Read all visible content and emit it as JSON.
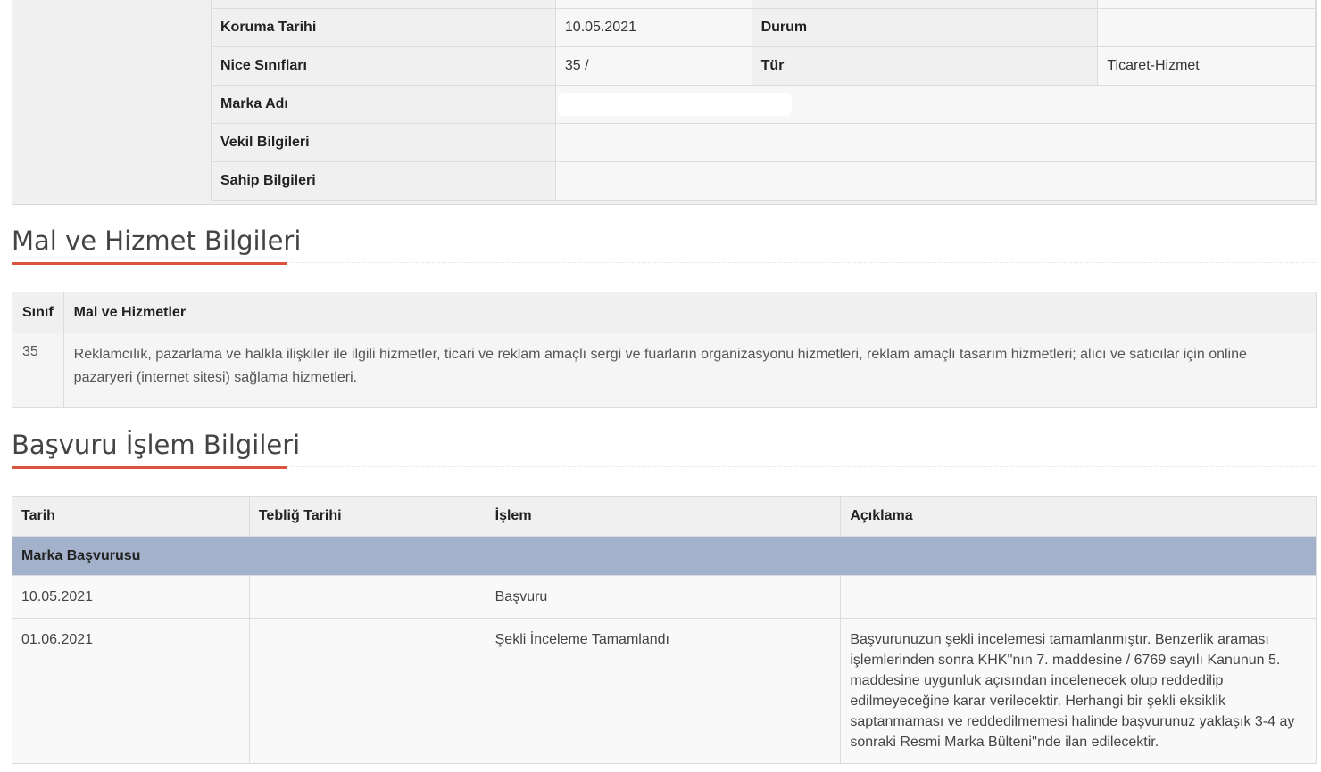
{
  "trademark_info": {
    "rows": [
      {
        "label": "Koruma Tarihi",
        "value": "10.05.2021",
        "label2": "Durum",
        "value2": ""
      },
      {
        "label": "Nice Sınıfları",
        "value": "35 /",
        "label2": "Tür",
        "value2": "Ticaret-Hizmet"
      },
      {
        "label": "Marka Adı",
        "value": ""
      },
      {
        "label": "Vekil Bilgileri",
        "value": ""
      },
      {
        "label": "Sahip Bilgileri",
        "value": ""
      }
    ]
  },
  "goods_section": {
    "title": "Mal ve Hizmet Bilgileri",
    "headers": {
      "class": "Sınıf",
      "goods": "Mal ve Hizmetler"
    },
    "rows": [
      {
        "class": "35",
        "goods": "Reklamcılık, pazarlama ve halkla ilişkiler ile ilgili hizmetler, ticari ve reklam amaçlı sergi ve fuarların organizasyonu hizmetleri, reklam amaçlı tasarım hizmetleri; alıcı ve satıcılar için online pazaryeri (internet sitesi) sağlama hizmetleri."
      }
    ]
  },
  "transactions_section": {
    "title": "Başvuru İşlem Bilgileri",
    "headers": {
      "date": "Tarih",
      "notify_date": "Tebliğ Tarihi",
      "action": "İşlem",
      "description": "Açıklama"
    },
    "group_label": "Marka Başvurusu",
    "rows": [
      {
        "date": "10.05.2021",
        "notify_date": "",
        "action": "Başvuru",
        "description": ""
      },
      {
        "date": "01.06.2021",
        "notify_date": "",
        "action": "Şekli İnceleme Tamamlandı",
        "description": "Başvurunuzun şekli incelemesi tamamlanmıştır. Benzerlik araması işlemlerinden sonra KHK''nın 7. maddesine / 6769 sayılı Kanunun 5. maddesine uygunluk açısından incelenecek olup reddedilip edilmeyeceğine karar verilecektir. Herhangi bir şekli eksiklik saptanmaması ve reddedilmemesi halinde başvurunuz yaklaşık 3-4 ay sonraki Resmi Marka Bülteni''nde ilan edilecektir."
      }
    ]
  },
  "colors": {
    "accent": "#d9533f",
    "group_row": "#a3b1cb"
  }
}
